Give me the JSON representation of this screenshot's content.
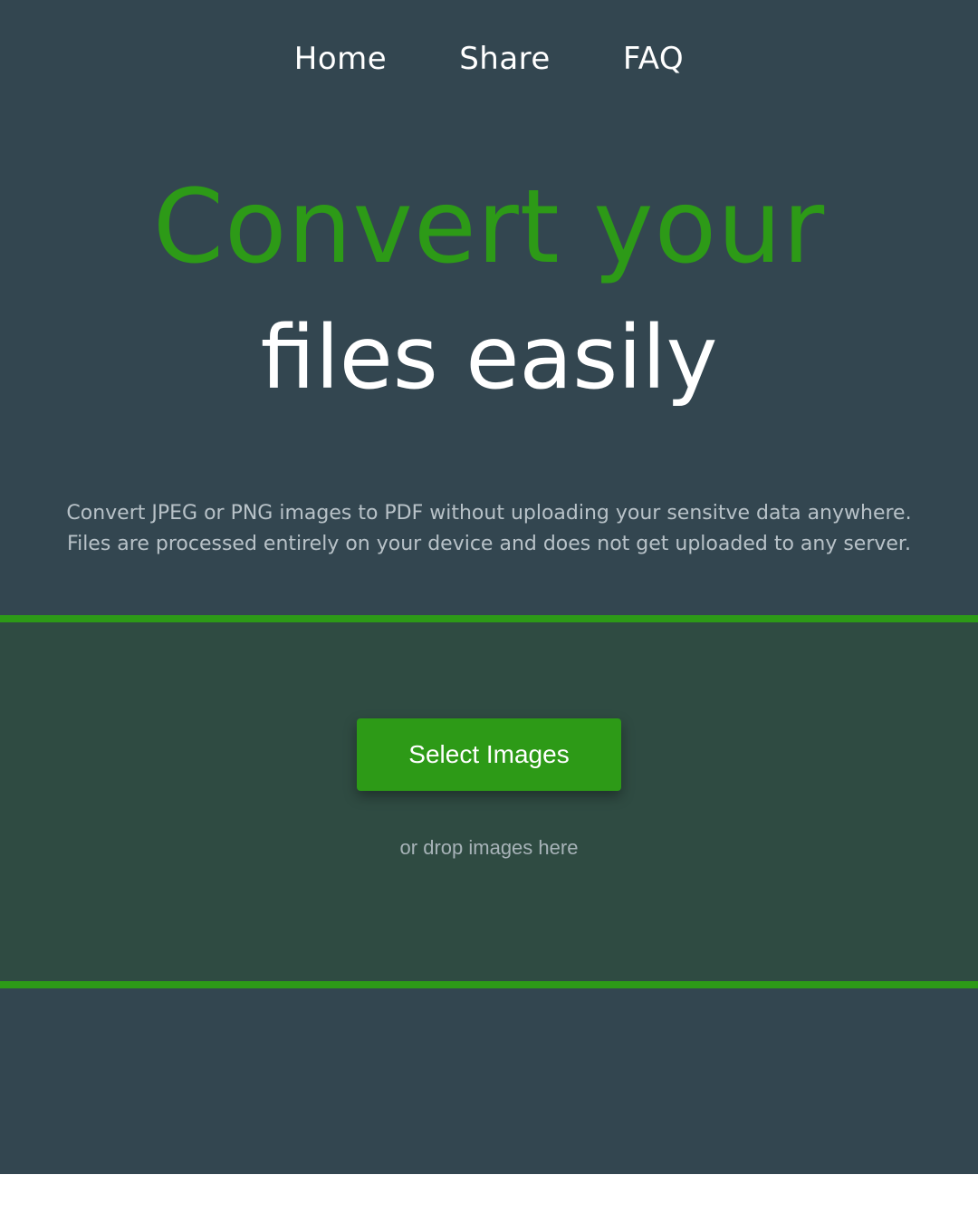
{
  "nav": {
    "items": [
      {
        "label": "Home"
      },
      {
        "label": "Share"
      },
      {
        "label": "FAQ"
      }
    ]
  },
  "hero": {
    "line1": "Convert your",
    "line2": "files easily"
  },
  "description": {
    "line1": "Convert JPEG or PNG images to PDF without uploading your sensitve data anywhere.",
    "line2": "Files are processed entirely on your device and does not get uploaded to any server."
  },
  "dropzone": {
    "button_label": "Select Images",
    "hint": "or drop images here"
  },
  "colors": {
    "background": "#334650",
    "accent": "#2d9a17",
    "dropzone_bg": "#2f4b42"
  }
}
